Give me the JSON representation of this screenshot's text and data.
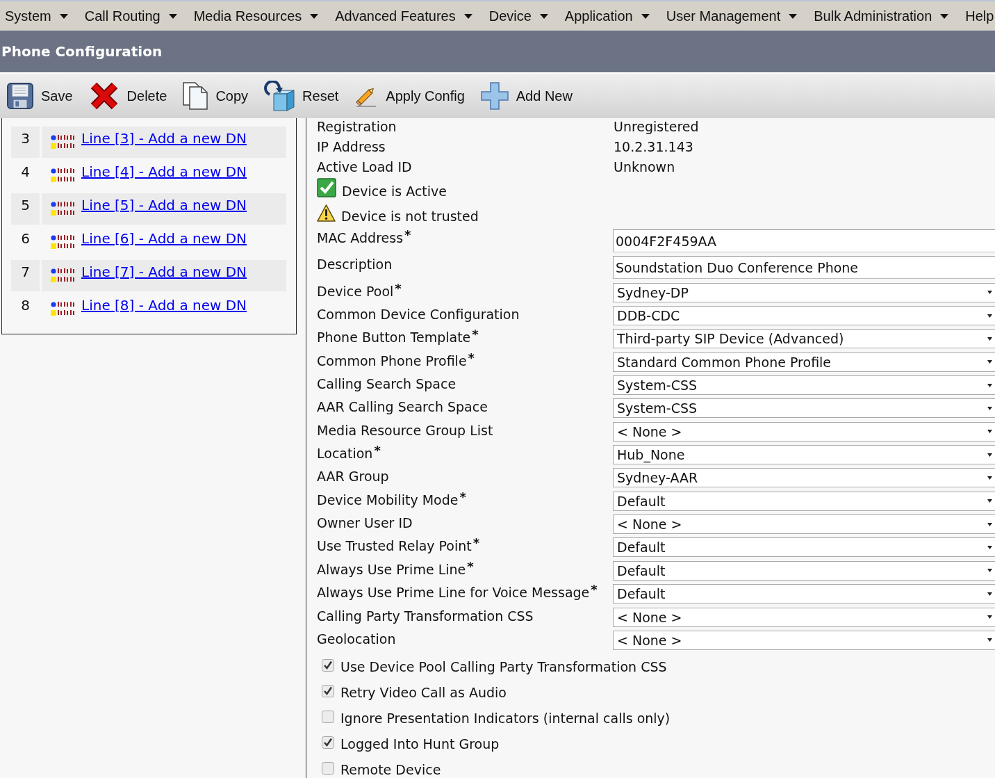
{
  "menu_bar": {
    "items": [
      {
        "label": "System",
        "dropdown": true
      },
      {
        "label": "Call Routing",
        "dropdown": true
      },
      {
        "label": "Media Resources",
        "dropdown": true
      },
      {
        "label": "Advanced Features",
        "dropdown": true
      },
      {
        "label": "Device",
        "dropdown": true
      },
      {
        "label": "Application",
        "dropdown": true
      },
      {
        "label": "User Management",
        "dropdown": true
      },
      {
        "label": "Bulk Administration",
        "dropdown": true
      },
      {
        "label": "Help",
        "dropdown": false
      }
    ]
  },
  "page_header": {
    "title": "Phone Configuration"
  },
  "toolbar": {
    "buttons": [
      {
        "kind": "save",
        "label": "Save"
      },
      {
        "kind": "delete",
        "label": "Delete"
      },
      {
        "kind": "copy",
        "label": "Copy"
      },
      {
        "kind": "reset",
        "label": "Reset"
      },
      {
        "kind": "apply_config",
        "label": "Apply Config"
      },
      {
        "kind": "add_new",
        "label": "Add New"
      }
    ]
  },
  "line_panel": {
    "rows": [
      {
        "number": "3",
        "link": "Line [3] - Add a new DN"
      },
      {
        "number": "4",
        "link": "Line [4] - Add a new DN"
      },
      {
        "number": "5",
        "link": "Line [5] - Add a new DN"
      },
      {
        "number": "6",
        "link": "Line [6] - Add a new DN"
      },
      {
        "number": "7",
        "link": "Line [7] - Add a new DN"
      },
      {
        "number": "8",
        "link": "Line [8] - Add a new DN"
      }
    ]
  },
  "device_info": [
    {
      "label": "Registration",
      "value": "Unregistered"
    },
    {
      "label": "IP Address",
      "value": "10.2.31.143"
    },
    {
      "label": "Active Load ID",
      "value": "Unknown"
    }
  ],
  "status_messages": [
    {
      "kind": "ok",
      "text": "Device is Active"
    },
    {
      "kind": "warning",
      "text": "Device is not trusted"
    }
  ],
  "fields": [
    {
      "kind": "text",
      "label": "MAC Address$^{*}$",
      "value": "0004F2F459AA"
    },
    {
      "kind": "text",
      "label": "Description",
      "value": "Soundstation Duo Conference Phone"
    },
    {
      "kind": "select",
      "label": "Device Pool$^{*}$",
      "value": "Sydney-DP"
    },
    {
      "kind": "select",
      "label": "Common Device Configuration",
      "value": "DDB-CDC"
    },
    {
      "kind": "select",
      "label": "Phone Button Template$^{*}$",
      "value": "Third-party SIP Device (Advanced)"
    },
    {
      "kind": "select",
      "label": "Common Phone Profile$^{*}$",
      "value": "Standard Common Phone Profile"
    },
    {
      "kind": "select",
      "label": "Calling Search Space",
      "value": "System-CSS"
    },
    {
      "kind": "select",
      "label": "AAR Calling Search Space",
      "value": "System-CSS"
    },
    {
      "kind": "select",
      "label": "Media Resource Group List",
      "value": "< None >"
    },
    {
      "kind": "select",
      "label": "Location$^{*}$",
      "value": "Hub_None"
    },
    {
      "kind": "select",
      "label": "AAR Group",
      "value": "Sydney-AAR"
    },
    {
      "kind": "select",
      "label": "Device Mobility Mode$^{*}$",
      "value": "Default"
    },
    {
      "kind": "select",
      "label": "Owner User ID",
      "value": "< None >"
    },
    {
      "kind": "select",
      "label": "Use Trusted Relay Point$^{*}$",
      "value": "Default"
    },
    {
      "kind": "select",
      "label": "Always Use Prime Line$^{*}$",
      "value": "Default"
    },
    {
      "kind": "select",
      "label": "Always Use Prime Line for Voice Message$^{*}$",
      "value": "Default"
    },
    {
      "kind": "select",
      "label": "Calling Party Transformation CSS",
      "value": "< None >"
    },
    {
      "kind": "select",
      "label": "Geolocation",
      "value": "< None >"
    }
  ],
  "options": [
    {
      "label": "Use Device Pool Calling Party Transformation CSS",
      "checked": true
    },
    {
      "label": "Retry Video Call as Audio",
      "checked": true
    },
    {
      "label": "Ignore Presentation Indicators (internal calls only)",
      "checked": false
    },
    {
      "label": "Logged Into Hunt Group",
      "checked": true
    },
    {
      "label": "Remote Device",
      "checked": false
    }
  ]
}
